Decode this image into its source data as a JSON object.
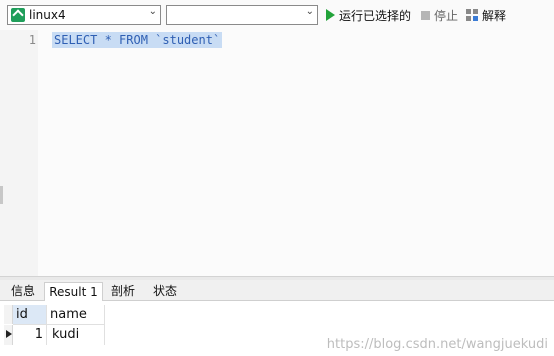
{
  "toolbar": {
    "connection": "linux4",
    "database": "",
    "run_label": "运行已选择的",
    "stop_label": "停止",
    "explain_label": "解释"
  },
  "editor": {
    "line_number": "1",
    "code": "SELECT * FROM `student`"
  },
  "tabs": [
    {
      "label": "信息"
    },
    {
      "label": "Result 1"
    },
    {
      "label": "剖析"
    },
    {
      "label": "状态"
    }
  ],
  "grid": {
    "columns": [
      "id",
      "name"
    ],
    "rows": [
      {
        "id": "1",
        "name": "kudi"
      }
    ]
  },
  "watermark": "https://blog.csdn.net/wangjuekudi",
  "colors": {
    "run_icon": "#22a33a",
    "connection_icon": "#1f9e5a",
    "selection": "#c8dcf4"
  },
  "icons": [
    "connection-icon",
    "run-icon",
    "stop-icon",
    "explain-icon",
    "chevron-down-icon"
  ]
}
